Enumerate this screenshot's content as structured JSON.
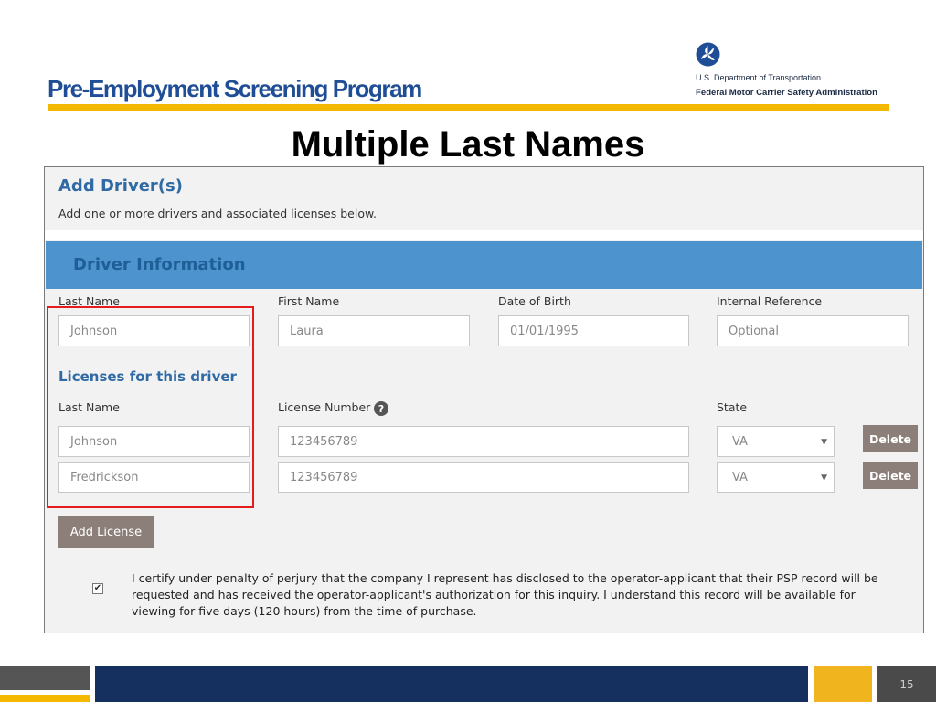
{
  "header": {
    "program_title": "Pre-Employment Screening Program",
    "agency_line1": "U.S. Department of Transportation",
    "agency_line2": "Federal Motor Carrier Safety Administration",
    "logo_icon": "dot-triskelion-logo-icon"
  },
  "slide_heading": "Multiple Last Names",
  "form": {
    "title": "Add Driver(s)",
    "subtitle": "Add one or more drivers and associated licenses below.",
    "section_title": "Driver Information",
    "driver": {
      "last_name_label": "Last Name",
      "last_name_value": "Johnson",
      "first_name_label": "First Name",
      "first_name_value": "Laura",
      "dob_label": "Date of Birth",
      "dob_value": "01/01/1995",
      "internal_ref_label": "Internal Reference",
      "internal_ref_placeholder": "Optional"
    },
    "licenses": {
      "title": "Licenses for this driver",
      "last_name_label": "Last Name",
      "license_number_label": "License Number",
      "state_label": "State",
      "rows": [
        {
          "last_name": "Johnson",
          "license_number": "123456789",
          "state": "VA",
          "delete_label": "Delete"
        },
        {
          "last_name": "Fredrickson",
          "license_number": "123456789",
          "state": "VA",
          "delete_label": "Delete"
        }
      ]
    },
    "add_license_label": "Add License",
    "certify_checked": true,
    "certify_text": "I certify under penalty of perjury that the company I represent has disclosed to the operator-applicant that their PSP record will be requested and has received the operator-applicant's authorization for this inquiry. I understand this record will be available for viewing for five days (120 hours) from the time of purchase."
  },
  "footer": {
    "page_number": "15"
  },
  "colors": {
    "brand_blue": "#1f4e96",
    "gold": "#f5b800",
    "section_bar": "#4d93cd",
    "highlight_red": "#e31d1d",
    "button_taupe": "#8c7f79",
    "footer_navy": "#15305e"
  }
}
